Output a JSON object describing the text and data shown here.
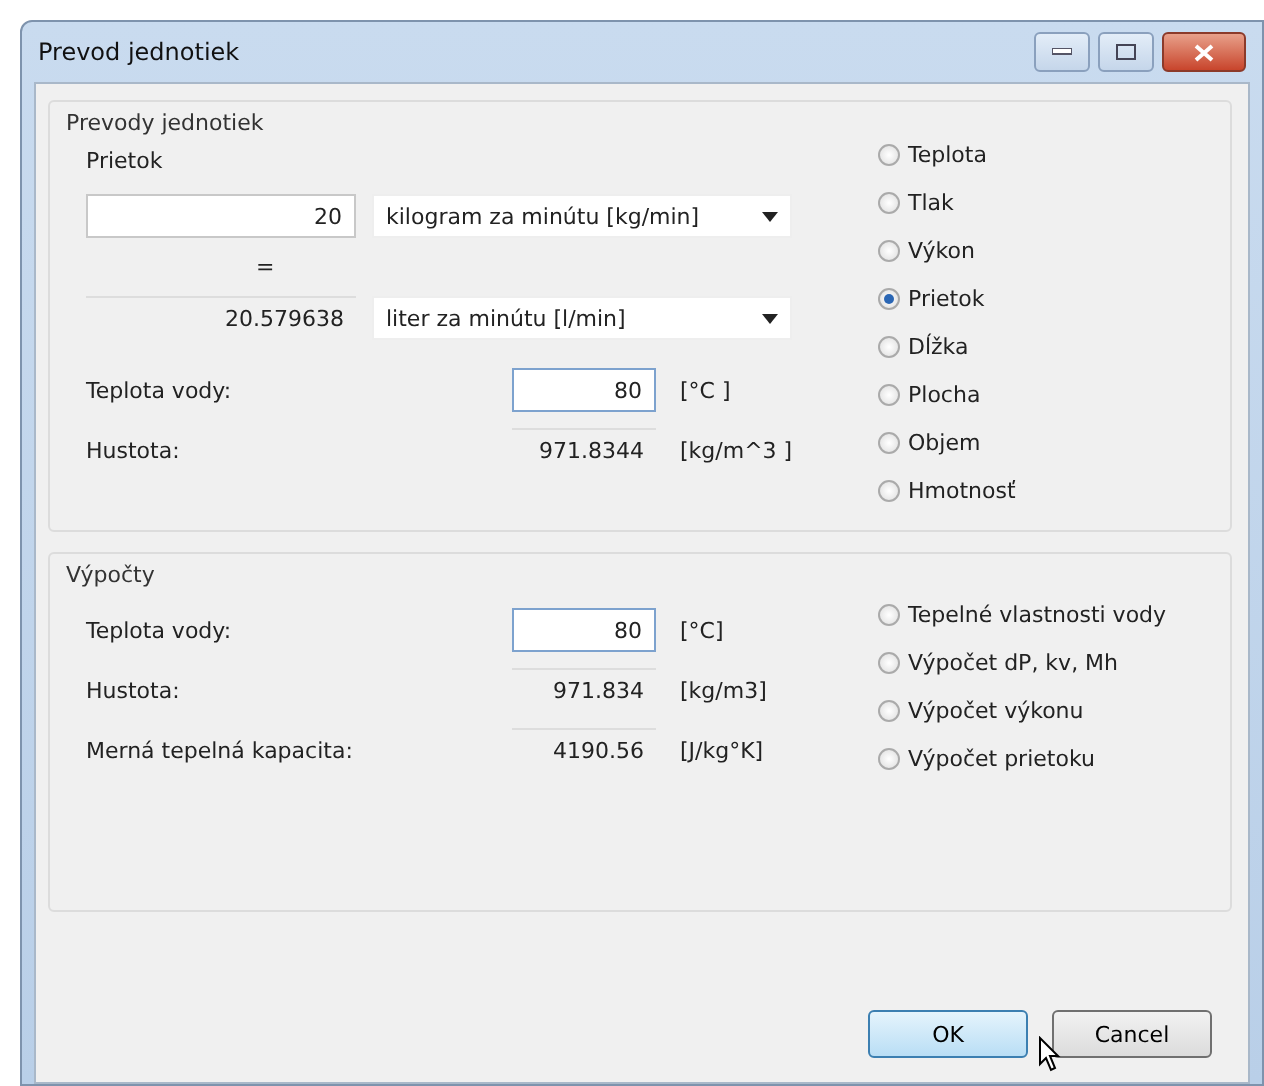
{
  "window": {
    "title": "Prevod jednotiek"
  },
  "conversion": {
    "title": "Prevody jednotiek",
    "subtitle": "Prietok",
    "input": {
      "value": "20"
    },
    "input_unit": "kilogram za minútu [kg/min]",
    "equals": "=",
    "output": "20.579638",
    "output_unit": "liter za minútu [l/min]",
    "fields": [
      {
        "label": "Teplota vody:",
        "kind": "input",
        "value": "80",
        "unit": "[°C ]"
      },
      {
        "label": "Hustota:",
        "kind": "readout",
        "value": "971.8344",
        "unit": "[kg/m^3 ]"
      }
    ],
    "quantities": [
      {
        "label": "Teplota",
        "selected": false
      },
      {
        "label": "Tlak",
        "selected": false
      },
      {
        "label": "Výkon",
        "selected": false
      },
      {
        "label": "Prietok",
        "selected": true
      },
      {
        "label": "Dĺžka",
        "selected": false
      },
      {
        "label": "Plocha",
        "selected": false
      },
      {
        "label": "Objem",
        "selected": false
      },
      {
        "label": "Hmotnosť",
        "selected": false
      }
    ]
  },
  "calculations": {
    "title": "Výpočty",
    "fields": [
      {
        "label": "Teplota vody:",
        "kind": "input",
        "value": "80",
        "unit": "[°C]"
      },
      {
        "label": "Hustota:",
        "kind": "readout",
        "value": "971.834",
        "unit": "[kg/m3]"
      },
      {
        "label": "Merná tepelná kapacita:",
        "kind": "readout",
        "value": "4190.56",
        "unit": "[J/kg°K]"
      }
    ],
    "modes": [
      {
        "label": "Tepelné vlastnosti vody",
        "selected": false
      },
      {
        "label": "Výpočet dP, kv, Mh",
        "selected": false
      },
      {
        "label": "Výpočet výkonu",
        "selected": false
      },
      {
        "label": "Výpočet prietoku",
        "selected": false
      }
    ]
  },
  "buttons": [
    {
      "label": "OK",
      "kind": "default"
    },
    {
      "label": "Cancel",
      "kind": "normal"
    }
  ]
}
